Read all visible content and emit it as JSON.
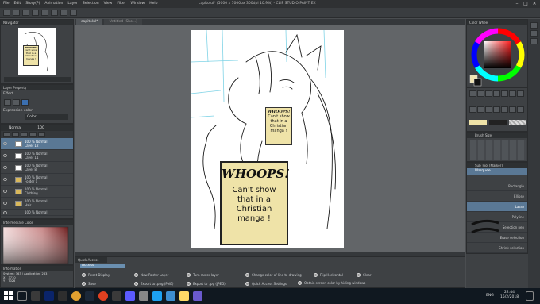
{
  "app": {
    "title": "capitolul* (5000 x 7000px 300dpi 10.9%)  -  CLIP STUDIO PAINT EX",
    "menu": [
      "File",
      "Edit",
      "Story(P)",
      "Animation",
      "Layer",
      "Selection",
      "View",
      "Filter",
      "Window",
      "Help"
    ]
  },
  "tabs": {
    "canvas_tab": "capitolul*",
    "canvas_tab2": "Untitled (Sho...)",
    "navigator": "Navigator"
  },
  "layer_property": {
    "header": "Layer Property",
    "effect_label": "Effect",
    "expression_label": "Expression color",
    "expression_value": "Color"
  },
  "layers": {
    "blend_mode": "Normal",
    "opacity": "100",
    "items": [
      {
        "line1": "100 % Normal",
        "line2": "Layer 12",
        "selected": true
      },
      {
        "line1": "100 % Normal",
        "line2": "Layer 11",
        "selected": false
      },
      {
        "line1": "100 % Normal",
        "line2": "Layer 8",
        "selected": false
      },
      {
        "line1": "100 % Normal",
        "line2": "Folder 1",
        "selected": false
      },
      {
        "line1": "100 % Normal",
        "line2": "Clothing",
        "selected": false
      },
      {
        "line1": "100 % Normal",
        "line2": "Hair",
        "selected": false
      },
      {
        "line1": "100 % Normal",
        "line2": "",
        "selected": false
      }
    ]
  },
  "intermediate": {
    "header": "Intermediate Color"
  },
  "info": {
    "header": "Information",
    "system": "System: 363 / Application: 283",
    "x": "3770",
    "y": "7026"
  },
  "canvas_text": {
    "big_title": "WHOOPS!",
    "big_body": [
      "Can't show",
      "that in a",
      "Christian",
      "manga !"
    ],
    "small_title": "WHOOPS!",
    "small_body": [
      "Can't show",
      "that in a",
      "Christian",
      "manga !"
    ],
    "nav_title": "WHOOPS!",
    "nav_body": [
      "Can't show",
      "that in a",
      "Christian",
      "manga !"
    ]
  },
  "right_panel": {
    "color_header": "Color Wheel",
    "brush_header": "Brush Size",
    "sub_tool_header": "Sub Tool [Marker]",
    "sub_tool_tab": "Marquee",
    "items": [
      {
        "label": "Rectangle",
        "selected": false
      },
      {
        "label": "Ellipse",
        "selected": false
      },
      {
        "label": "Lasso",
        "selected": true
      },
      {
        "label": "Polyline",
        "selected": false
      },
      {
        "label": "Selection pen",
        "selected": false
      },
      {
        "label": "Erase selection",
        "selected": false
      },
      {
        "label": "Shrink selection",
        "selected": false
      }
    ]
  },
  "quick_access": {
    "header": "Quick Access",
    "tab": "Access",
    "items": [
      "Reset Display",
      "New Raster Layer",
      "Turn raster layer",
      "Change color of line to drawing",
      "Flip Horizontal",
      "Clear",
      "Save",
      "Export to .png (PNG)",
      "Export to .jpg (JPEG)",
      "Quick Access Settings",
      "Obtain screen color by hiding windows"
    ]
  },
  "taskbar": {
    "time": "22:44",
    "date": "15/2/2018",
    "lang": "ENG"
  },
  "colors": {
    "accent": "#5a7895",
    "canvas_bg": "#626568",
    "panel_bg": "#3e4144",
    "sign_yellow": "#efe3a8"
  }
}
